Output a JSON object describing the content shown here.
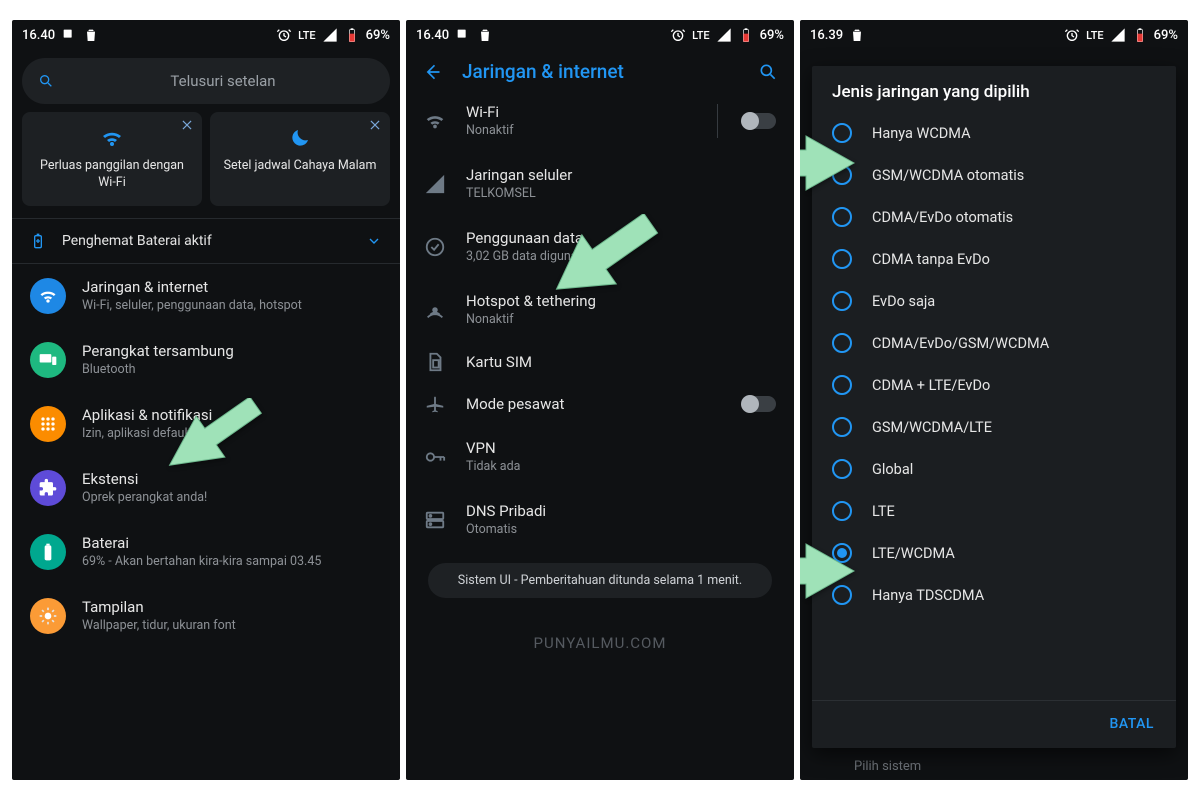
{
  "status": {
    "time_a": "16.40",
    "time_b": "16.40",
    "time_c": "16.39",
    "net": "LTE",
    "battery": "69%"
  },
  "screen1": {
    "search_placeholder": "Telusuri setelan",
    "card1": "Perluas panggilan dengan Wi-Fi",
    "card2": "Setel jadwal Cahaya Malam",
    "notice": "Penghemat Baterai aktif",
    "items": [
      {
        "title": "Jaringan & internet",
        "sub": "Wi-Fi, seluler, penggunaan data, hotspot",
        "color": "c-blue",
        "icon": "wifi"
      },
      {
        "title": "Perangkat tersambung",
        "sub": "Bluetooth",
        "color": "c-green",
        "icon": "devices"
      },
      {
        "title": "Aplikasi & notifikasi",
        "sub": "Izin, aplikasi default",
        "color": "c-orange",
        "icon": "apps"
      },
      {
        "title": "Ekstensi",
        "sub": "Oprek perangkat anda!",
        "color": "c-purple",
        "icon": "ext"
      },
      {
        "title": "Baterai",
        "sub": "69% - Akan bertahan kira-kira sampai 03.45",
        "color": "c-teal",
        "icon": "battery"
      },
      {
        "title": "Tampilan",
        "sub": "Wallpaper, tidur, ukuran font",
        "color": "c-amber",
        "icon": "display"
      }
    ]
  },
  "screen2": {
    "title": "Jaringan & internet",
    "items": [
      {
        "title": "Wi-Fi",
        "sub": "Nonaktif",
        "icon": "wifi",
        "toggle": true
      },
      {
        "title": "Jaringan seluler",
        "sub": "TELKOMSEL",
        "icon": "signal"
      },
      {
        "title": "Penggunaan data",
        "sub": "3,02 GB data digunakan",
        "icon": "data"
      },
      {
        "title": "Hotspot & tethering",
        "sub": "Nonaktif",
        "icon": "hotspot"
      },
      {
        "title": "Kartu SIM",
        "sub": "",
        "icon": "sim"
      },
      {
        "title": "Mode pesawat",
        "sub": "",
        "icon": "plane",
        "toggle": true
      },
      {
        "title": "VPN",
        "sub": "Tidak ada",
        "icon": "vpn"
      },
      {
        "title": "DNS Pribadi",
        "sub": "Otomatis",
        "icon": "dns"
      }
    ],
    "toast": "Sistem UI - Pemberitahuan ditunda selama 1 menit.",
    "watermark": "PUNYAILMU.COM"
  },
  "screen3": {
    "dialog_title": "Jenis jaringan yang dipilih",
    "options": [
      "Hanya WCDMA",
      "GSM/WCDMA otomatis",
      "CDMA/EvDo otomatis",
      "CDMA tanpa EvDo",
      "EvDo saja",
      "CDMA/EvDo/GSM/WCDMA",
      "CDMA + LTE/EvDo",
      "GSM/WCDMA/LTE",
      "Global",
      "LTE",
      "LTE/WCDMA",
      "Hanya TDSCDMA"
    ],
    "selected": 10,
    "cancel": "BATAL",
    "ghost": "Pilih sistem"
  }
}
